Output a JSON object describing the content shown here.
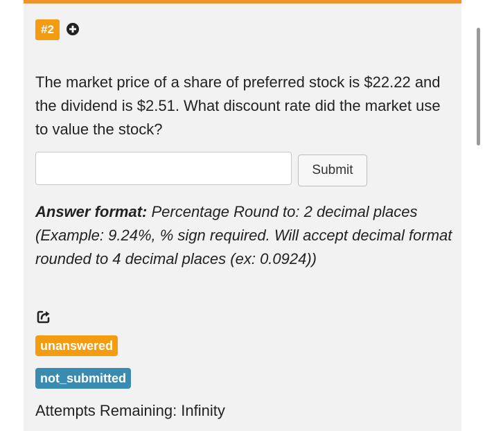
{
  "question": {
    "number": "#2",
    "text": "The market price of a share of preferred stock is $22.22 and the dividend is $2.51. What discount rate did the market use to value the stock?"
  },
  "answer": {
    "value": "",
    "submit_label": "Submit"
  },
  "format": {
    "label": "Answer format:",
    "text": " Percentage Round to: 2 decimal places (Example: 9.24%, % sign required. Will accept decimal format rounded to 4 decimal places (ex: 0.0924))"
  },
  "status": {
    "answer_badge": "unanswered",
    "submission_badge": "not_submitted",
    "attempts": "Attempts Remaining: Infinity"
  },
  "colors": {
    "accent_orange": "#f39c12",
    "badge_blue": "#3a8bb0",
    "card_background": "#f2f2f2"
  },
  "icons": {
    "add": "plus-circle-icon",
    "share": "share-icon"
  }
}
